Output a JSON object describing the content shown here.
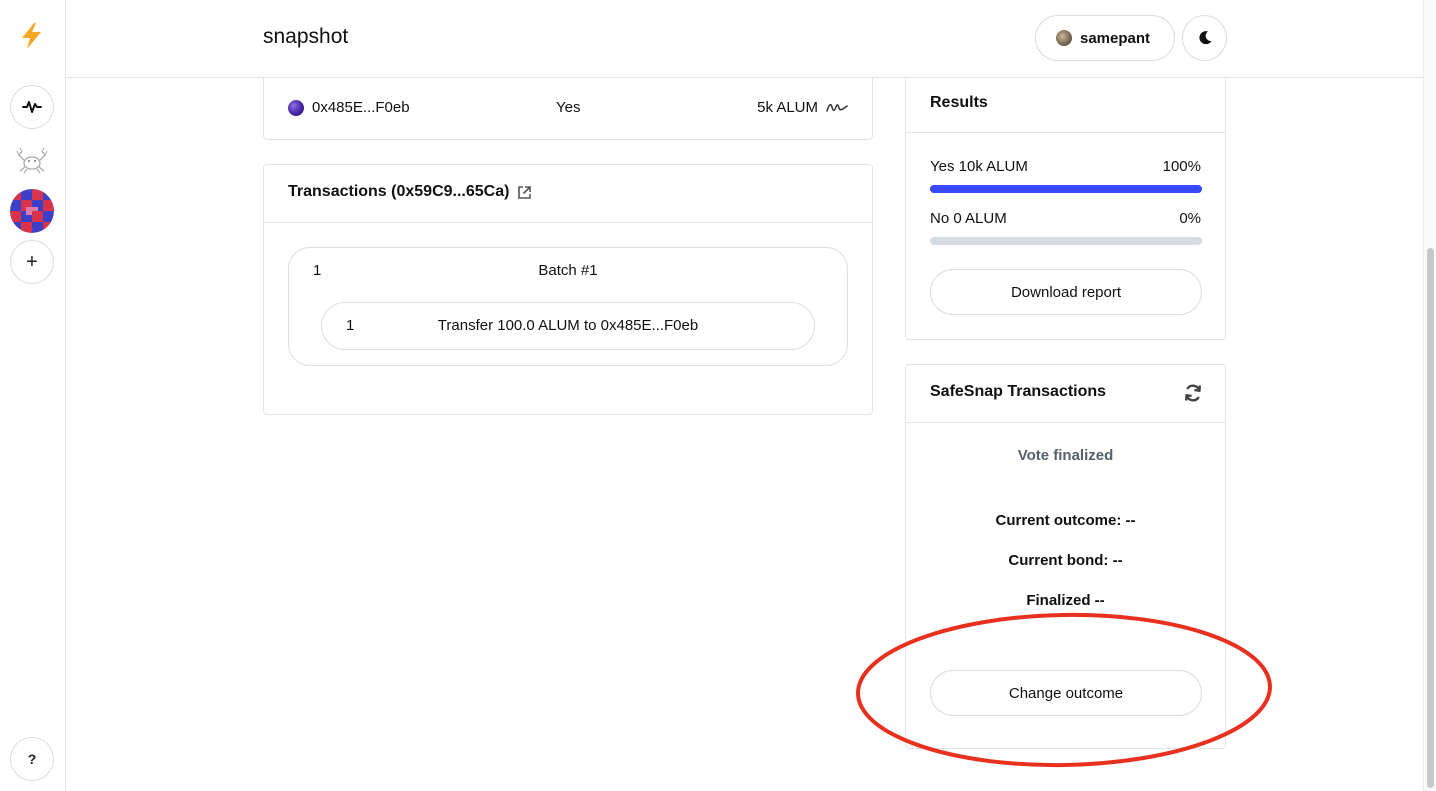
{
  "header": {
    "brand": "snapshot",
    "user_name": "samepant"
  },
  "sidebar": {
    "icons": [
      "lightning-icon",
      "activity-icon",
      "crab-space-icon",
      "space-avatar",
      "plus-icon",
      "help-icon"
    ],
    "help_label": "?",
    "plus_label": "+"
  },
  "vote": {
    "voter": "0x485E...F0eb",
    "choice": "Yes",
    "power": "5k ALUM"
  },
  "transactions": {
    "title": "Transactions (0x59C9...65Ca)",
    "batch_number": "1",
    "batch_label": "Batch #1",
    "items": [
      {
        "number": "1",
        "label": "Transfer 100.0 ALUM to 0x485E...F0eb"
      }
    ]
  },
  "results": {
    "title": "Results",
    "choices": [
      {
        "label": "Yes 10k ALUM",
        "percent_text": "100%",
        "fraction": 1.0
      },
      {
        "label": "No 0 ALUM",
        "percent_text": "0%",
        "fraction": 0.0
      }
    ],
    "download_label": "Download report"
  },
  "safesnap": {
    "title": "SafeSnap Transactions",
    "status": "Vote finalized",
    "current_outcome": "Current outcome: --",
    "current_bond": "Current bond: --",
    "finalized": "Finalized --",
    "change_outcome_label": "Change outcome"
  },
  "colors": {
    "accent": "#384aff",
    "annotation": "#e8301e",
    "bar_track": "#d5dbe2",
    "lightning": "#f5a623"
  }
}
